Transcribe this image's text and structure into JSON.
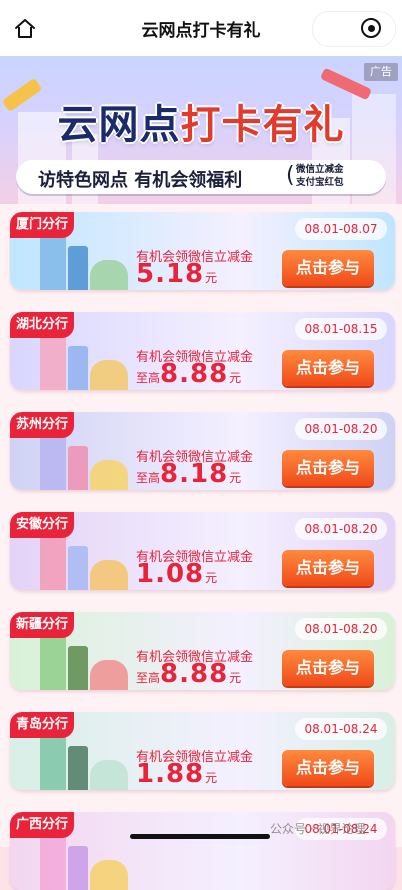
{
  "nav": {
    "title": "云网点打卡有礼"
  },
  "hero": {
    "ad_badge": "广告",
    "title_part1": "云网点",
    "title_part2": "打卡有礼",
    "subtitle": "访特色网点 有机会领福利",
    "side_line1": "微信立减金",
    "side_line2": "支付宝红包"
  },
  "cards": [
    {
      "branch": "厦门分行",
      "date": "08.01-08.07",
      "prize_label": "有机会领微信立减金",
      "prefix": "",
      "amount": "5.18",
      "unit": "元",
      "button": "点击参与",
      "bg": "#bfe6ff"
    },
    {
      "branch": "湖北分行",
      "date": "08.01-08.15",
      "prize_label": "有机会领微信立减金",
      "prefix": "至高",
      "amount": "8.88",
      "unit": "元",
      "button": "点击参与",
      "bg": "#d9d6ff"
    },
    {
      "branch": "苏州分行",
      "date": "08.01-08.20",
      "prize_label": "有机会领微信立减金",
      "prefix": "至高",
      "amount": "8.18",
      "unit": "元",
      "button": "点击参与",
      "bg": "#cfd2f4"
    },
    {
      "branch": "安徽分行",
      "date": "08.01-08.20",
      "prize_label": "有机会领微信立减金",
      "prefix": "",
      "amount": "1.08",
      "unit": "元",
      "button": "点击参与",
      "bg": "#e3d3f7"
    },
    {
      "branch": "新疆分行",
      "date": "08.01-08.20",
      "prize_label": "有机会领微信立减金",
      "prefix": "至高",
      "amount": "8.88",
      "unit": "元",
      "button": "点击参与",
      "bg": "#d9f1d8"
    },
    {
      "branch": "青岛分行",
      "date": "08.01-08.24",
      "prize_label": "有机会领微信立减金",
      "prefix": "",
      "amount": "1.88",
      "unit": "元",
      "button": "点击参与",
      "bg": "#d8efe6"
    },
    {
      "branch": "广西分行",
      "date": "08.01-08.24",
      "prize_label": "",
      "prefix": "",
      "amount": "",
      "unit": "",
      "button": "",
      "bg": "#f3d6f0"
    }
  ],
  "watermark": "公众号 · 视界论理"
}
